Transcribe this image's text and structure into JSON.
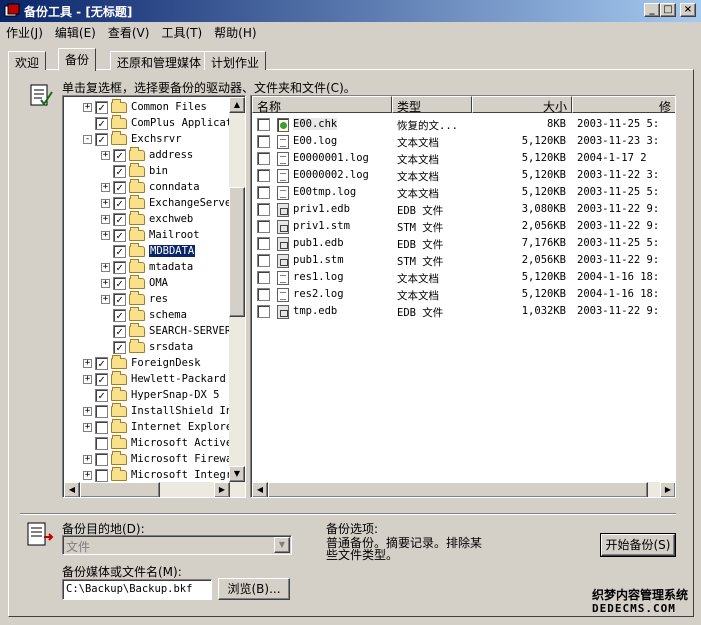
{
  "window": {
    "title": "备份工具 - [无标题]",
    "minimize": "_",
    "maximize": "□",
    "close": "×"
  },
  "menu": [
    "作业(J)",
    "编辑(E)",
    "查看(V)",
    "工具(T)",
    "帮助(H)"
  ],
  "tabs": [
    {
      "label": "欢迎",
      "active": false
    },
    {
      "label": "备份",
      "active": true
    },
    {
      "label": "还原和管理媒体",
      "active": false
    },
    {
      "label": "计划作业",
      "active": false
    }
  ],
  "instruction": "单击复选框，选择要备份的驱动器、文件夹和文件(C)。",
  "tree": [
    {
      "label": "Common Files",
      "expander": "+",
      "checked": true,
      "indent": 0
    },
    {
      "label": "ComPlus Applicat",
      "expander": "",
      "checked": true,
      "indent": 0
    },
    {
      "label": "Exchsrvr",
      "expander": "-",
      "checked": true,
      "indent": 0
    },
    {
      "label": "address",
      "expander": "+",
      "checked": true,
      "indent": 1
    },
    {
      "label": "bin",
      "expander": "",
      "checked": true,
      "indent": 1
    },
    {
      "label": "conndata",
      "expander": "+",
      "checked": true,
      "indent": 1
    },
    {
      "label": "ExchangeServe",
      "expander": "+",
      "checked": true,
      "indent": 1
    },
    {
      "label": "exchweb",
      "expander": "+",
      "checked": true,
      "indent": 1
    },
    {
      "label": "Mailroot",
      "expander": "+",
      "checked": true,
      "indent": 1
    },
    {
      "label": "MDBDATA",
      "expander": "",
      "checked": true,
      "indent": 1,
      "selected": true
    },
    {
      "label": "mtadata",
      "expander": "+",
      "checked": true,
      "indent": 1
    },
    {
      "label": "OMA",
      "expander": "+",
      "checked": true,
      "indent": 1
    },
    {
      "label": "res",
      "expander": "+",
      "checked": true,
      "indent": 1
    },
    {
      "label": "schema",
      "expander": "",
      "checked": true,
      "indent": 1
    },
    {
      "label": "SEARCH-SERVER",
      "expander": "",
      "checked": true,
      "indent": 1
    },
    {
      "label": "srsdata",
      "expander": "",
      "checked": true,
      "indent": 1
    },
    {
      "label": "ForeignDesk",
      "expander": "+",
      "checked": true,
      "indent": 0
    },
    {
      "label": "Hewlett-Packard",
      "expander": "+",
      "checked": true,
      "indent": 0
    },
    {
      "label": "HyperSnap-DX 5",
      "expander": "",
      "checked": true,
      "indent": 0
    },
    {
      "label": "InstallShield In",
      "expander": "+",
      "checked": false,
      "indent": 0
    },
    {
      "label": "Internet Explore",
      "expander": "+",
      "checked": false,
      "indent": 0
    },
    {
      "label": "Microsoft Active",
      "expander": "",
      "checked": false,
      "indent": 0
    },
    {
      "label": "Microsoft Firewa",
      "expander": "+",
      "checked": false,
      "indent": 0
    },
    {
      "label": "Microsoft Integr",
      "expander": "+",
      "checked": false,
      "indent": 0
    }
  ],
  "list": {
    "headers": [
      "名称",
      "类型",
      "大小",
      "修"
    ],
    "rows": [
      {
        "name": "E00.chk",
        "type": "恢复的文...",
        "size": "8KB",
        "date": "2003-11-25 5:",
        "icon": "chk",
        "highlight": true
      },
      {
        "name": "E00.log",
        "type": "文本文档",
        "size": "5,120KB",
        "date": "2003-11-23 3:",
        "icon": "log"
      },
      {
        "name": "E0000001.log",
        "type": "文本文档",
        "size": "5,120KB",
        "date": "2004-1-17 2",
        "icon": "log"
      },
      {
        "name": "E0000002.log",
        "type": "文本文档",
        "size": "5,120KB",
        "date": "2003-11-22 3:",
        "icon": "log"
      },
      {
        "name": "E00tmp.log",
        "type": "文本文档",
        "size": "5,120KB",
        "date": "2003-11-25 5:",
        "icon": "log"
      },
      {
        "name": "priv1.edb",
        "type": "EDB 文件",
        "size": "3,080KB",
        "date": "2003-11-22 9:",
        "icon": "db"
      },
      {
        "name": "priv1.stm",
        "type": "STM 文件",
        "size": "2,056KB",
        "date": "2003-11-22 9:",
        "icon": "db"
      },
      {
        "name": "pub1.edb",
        "type": "EDB 文件",
        "size": "7,176KB",
        "date": "2003-11-25 5:",
        "icon": "db"
      },
      {
        "name": "pub1.stm",
        "type": "STM 文件",
        "size": "2,056KB",
        "date": "2003-11-22 9:",
        "icon": "db"
      },
      {
        "name": "res1.log",
        "type": "文本文档",
        "size": "5,120KB",
        "date": "2004-1-16 18:",
        "icon": "log"
      },
      {
        "name": "res2.log",
        "type": "文本文档",
        "size": "5,120KB",
        "date": "2004-1-16 18:",
        "icon": "log"
      },
      {
        "name": "tmp.edb",
        "type": "EDB 文件",
        "size": "1,032KB",
        "date": "2003-11-22 9:",
        "icon": "db"
      }
    ]
  },
  "bottom": {
    "dest_label": "备份目的地(D):",
    "dest_value": "文件",
    "media_label": "备份媒体或文件名(M):",
    "media_value": "C:\\Backup\\Backup.bkf",
    "browse": "浏览(B)...",
    "options_title": "备份选项:",
    "options_text_1": "普通备份。摘要记录。排除某",
    "options_text_2": "些文件类型。",
    "start": "开始备份(S)"
  },
  "watermark": {
    "line1": "织梦内容管理系统",
    "line2": "DEDECMS.COM"
  }
}
